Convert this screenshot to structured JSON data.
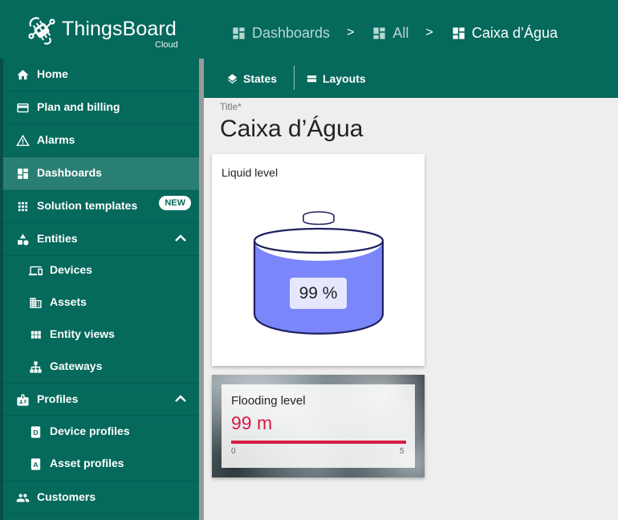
{
  "brand": {
    "name": "ThingsBoard",
    "sub": "Cloud"
  },
  "breadcrumbs": [
    {
      "label": "Dashboards"
    },
    {
      "label": "All"
    },
    {
      "label": "Caixa d’Água"
    }
  ],
  "breadcrumb_separator": ">",
  "sidebar": {
    "items": [
      {
        "label": "Home",
        "icon": "home-icon"
      },
      {
        "label": "Plan and billing",
        "icon": "credit-card-icon"
      },
      {
        "label": "Alarms",
        "icon": "warning-icon"
      },
      {
        "label": "Dashboards",
        "icon": "dashboard-icon",
        "selected": true
      },
      {
        "label": "Solution templates",
        "icon": "apps-grid-icon",
        "badge": "NEW"
      },
      {
        "label": "Entities",
        "icon": "shapes-icon",
        "expanded": true
      },
      {
        "label": "Devices",
        "icon": "devices-icon"
      },
      {
        "label": "Assets",
        "icon": "building-icon"
      },
      {
        "label": "Entity views",
        "icon": "view-module-icon"
      },
      {
        "label": "Gateways",
        "icon": "hub-icon"
      },
      {
        "label": "Profiles",
        "icon": "badge-icon",
        "expanded": true
      },
      {
        "label": "Device profiles",
        "icon": "device-profile-icon"
      },
      {
        "label": "Asset profiles",
        "icon": "asset-profile-icon"
      },
      {
        "label": "Customers",
        "icon": "people-icon"
      }
    ]
  },
  "toolbar": {
    "states_label": "States",
    "layouts_label": "Layouts"
  },
  "main": {
    "title_caption": "Title*",
    "title": "Caixa d’Água"
  },
  "widgets": {
    "liquid_level": {
      "title": "Liquid level",
      "value_text": "99 %",
      "fill_fraction": 0.99
    },
    "flooding_level": {
      "title": "Flooding level",
      "value_text": "99 m",
      "min_label": "0",
      "max_label": "5",
      "bar_fraction": 1.0
    }
  },
  "colors": {
    "primary": "#05695c",
    "tank_fill": "#7b86fb",
    "tank_stroke": "#1f2060",
    "accent_red": "#d81b47"
  }
}
